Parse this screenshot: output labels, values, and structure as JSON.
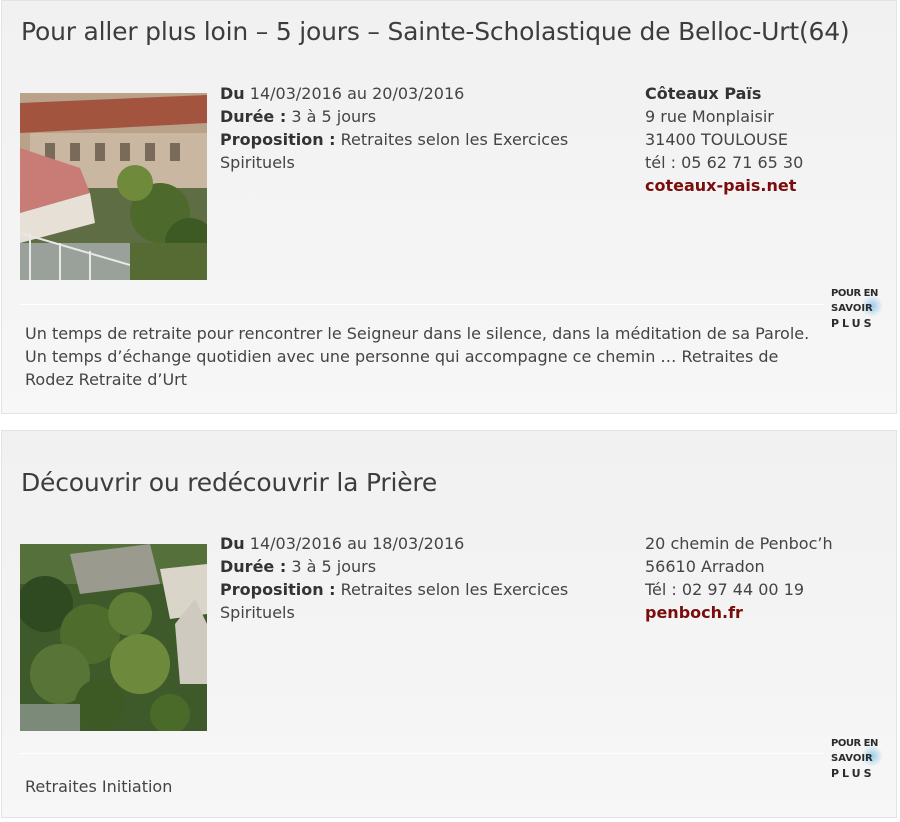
{
  "listings": [
    {
      "title": "Pour aller plus loin – 5 jours – Sainte-Scholastique de Belloc-Urt(64)",
      "date_label": "Du",
      "date_value": " 14/03/2016 au 20/03/2016",
      "duration_label": "Durée :",
      "duration_value": " 3 à 5 jours",
      "proposition_label": "Proposition :",
      "proposition_value": " Retraites selon les Exercices Spirituels",
      "contact_org": "Côteaux Païs",
      "contact_address": "9 rue Monplaisir",
      "contact_city": "31400 TOULOUSE",
      "contact_phone": "tél : 05 62 71 65 30",
      "contact_link": "coteaux-pais.net",
      "more_line1": "POUR EN",
      "more_line2": "SAVOIR",
      "more_line3": "PLUS",
      "description": "Un temps de retraite pour rencontrer le Seigneur dans le silence, dans la méditation de sa Parole. Un temps d’échange quotidien avec une personne qui accompagne ce chemin … Retraites de Rodez Retraite d’Urt"
    },
    {
      "title": "Découvrir ou redécouvrir la Prière",
      "date_label": "Du",
      "date_value": " 14/03/2016 au 18/03/2016",
      "duration_label": "Durée :",
      "duration_value": " 3 à 5 jours",
      "proposition_label": "Proposition :",
      "proposition_value": " Retraites selon les Exercices Spirituels",
      "contact_address": "20 chemin de Penboc’h",
      "contact_city": "56610 Arradon",
      "contact_phone": "Tél : 02 97 44 00 19",
      "contact_link": "penboch.fr",
      "more_line1": "POUR EN",
      "more_line2": "SAVOIR",
      "more_line3": "PLUS",
      "description": "Retraites Initiation"
    }
  ],
  "colors": {
    "link": "#7b0c0c",
    "title": "#3d3d3d",
    "card_bg": "#f3f3f3"
  },
  "icons": {
    "more": "pour-en-savoir-plus-logo"
  }
}
